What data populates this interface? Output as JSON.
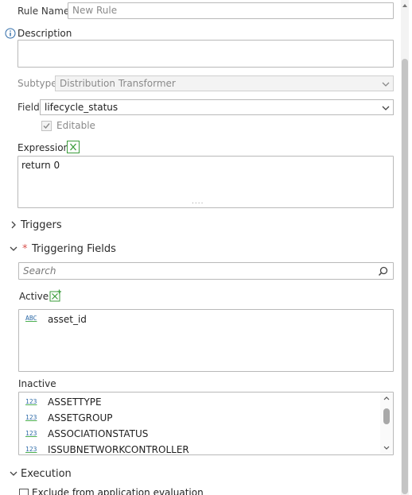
{
  "rule_name": {
    "label": "Rule Name",
    "placeholder": "New Rule"
  },
  "description": {
    "label": "Description",
    "value": ""
  },
  "subtype": {
    "label": "Subtype",
    "value": "Distribution Transformer"
  },
  "field": {
    "label": "Field",
    "value": "lifecycle_status"
  },
  "editable": {
    "label": "Editable",
    "checked": true
  },
  "expression": {
    "label": "Expression",
    "code": "return 0",
    "resize_grip": "...."
  },
  "triggers": {
    "label": "Triggers"
  },
  "triggering_fields": {
    "label": "Triggering Fields",
    "required_marker": "*",
    "search_placeholder": "Search",
    "active_label": "Active",
    "active_items": [
      {
        "type": "ABC",
        "name": "asset_id"
      }
    ],
    "inactive_label": "Inactive",
    "inactive_items": [
      {
        "type": "123",
        "name": "ASSETTYPE"
      },
      {
        "type": "123",
        "name": "ASSETGROUP"
      },
      {
        "type": "123",
        "name": "ASSOCIATIONSTATUS"
      },
      {
        "type": "123",
        "name": "ISSUBNETWORKCONTROLLER"
      }
    ]
  },
  "execution": {
    "label": "Execution",
    "exclude_label": "Exclude from application evaluation"
  },
  "colors": {
    "accent": "#2f6ba8",
    "required": "#d9534f",
    "excel_green": "#3a9b3a"
  },
  "icons": {
    "info": "info-icon",
    "excel": "expression-builder-icon",
    "search": "search-icon",
    "add_field": "add-field-icon"
  }
}
